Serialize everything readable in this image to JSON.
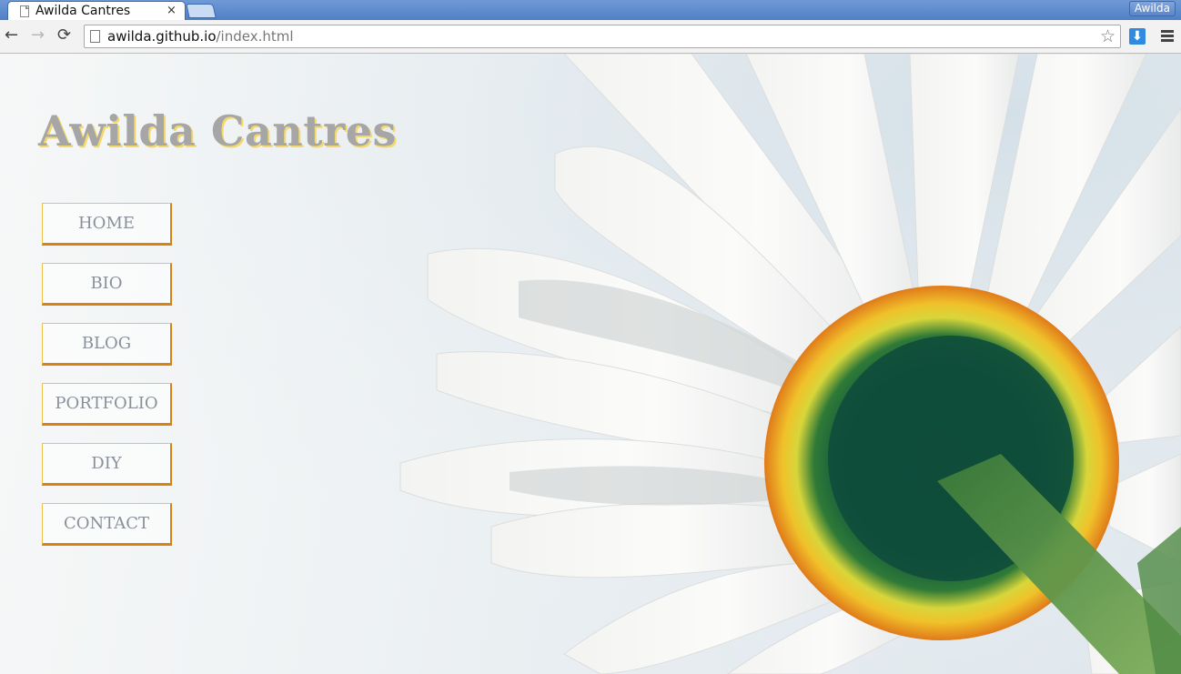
{
  "browser": {
    "tab_title": "Awilda Cantres",
    "tab_close": "×",
    "profile_name": "Awilda",
    "url_host": "awilda.github.io",
    "url_path": "/index.html"
  },
  "icons": {
    "back": "←",
    "forward": "→",
    "reload": "⟳",
    "star": "☆",
    "download": "⬇"
  },
  "site": {
    "title": "Awilda Cantres"
  },
  "nav": {
    "items": [
      {
        "label": "HOME"
      },
      {
        "label": "BIO"
      },
      {
        "label": "BLOG"
      },
      {
        "label": "PORTFOLIO"
      },
      {
        "label": "DIY"
      },
      {
        "label": "CONTACT"
      }
    ]
  },
  "colors": {
    "title_text": "#a6a6a6",
    "title_shadow": "#f4d86a",
    "button_border": "#d9820f",
    "button_text": "#8a9099"
  }
}
